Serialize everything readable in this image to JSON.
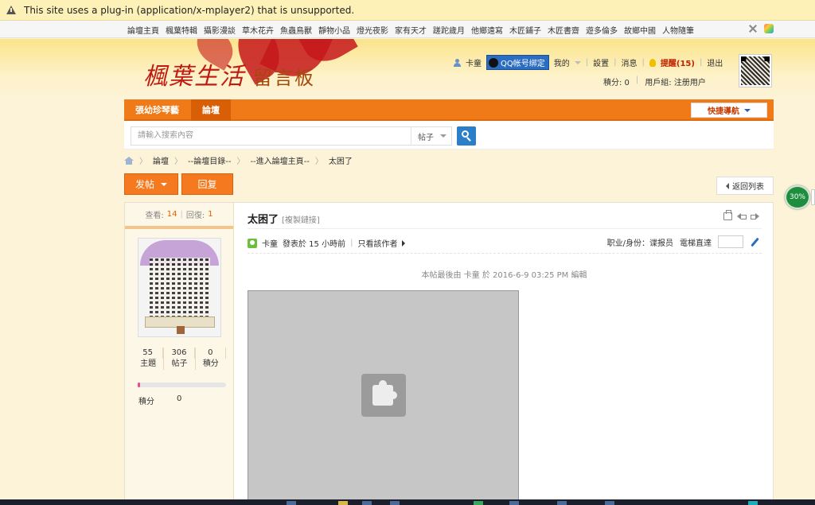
{
  "plugin_bar": {
    "message": "This site uses a plug-in (application/x-mplayer2) that is unsupported."
  },
  "top_links": [
    "論壇主頁",
    "楓葉特輯",
    "攝影漫談",
    "草木花卉",
    "魚蟲鳥獸",
    "靜物小品",
    "燈光夜影",
    "家有天才",
    "蹉跎歲月",
    "他鄉遠寫",
    "木匠鋪子",
    "木匠書齋",
    "遊多倫多",
    "故鄉中國",
    "人物隨筆"
  ],
  "header": {
    "logo_main": "楓葉生活",
    "logo_sub": "留言板",
    "username": "卡童",
    "qq_bind": "QQ帐号绑定",
    "my": "我的",
    "settings": "設置",
    "messages": "消息",
    "remind": "提醒(15)",
    "logout": "退出",
    "points": "積分: 0",
    "usergroup": "用戶組: 注册用户"
  },
  "navbar": {
    "tab1": "張幼珍琴藝",
    "tab2": "論壇",
    "quick_nav": "快捷導航"
  },
  "search": {
    "placeholder": "請輸入搜索內容",
    "type": "帖子"
  },
  "breadcrumb": [
    "論壇",
    "--論壇目錄--",
    "--進入論壇主頁--",
    "太困了"
  ],
  "actions": {
    "post": "发帖",
    "reply": "回复",
    "back_list": "返回列表"
  },
  "progress_badge": "30%",
  "sidebar": {
    "views_label": "查看:",
    "views": "14",
    "replies_label": "回復:",
    "replies": "1",
    "counts": [
      {
        "value": "55",
        "label": "主題"
      },
      {
        "value": "306",
        "label": "帖子"
      },
      {
        "value": "0",
        "label": "積分"
      }
    ],
    "score_label": "積分",
    "score_value": "0",
    "score_progress": 0.03
  },
  "post": {
    "title": "太困了",
    "copy_link": "[複製鏈接]",
    "author": "卡童",
    "posted": "發表於 15 小時前",
    "only_author": "只看該作者",
    "role": "职业/身份：谍报员",
    "jump": "電梯直達",
    "edit_note": "本帖最後由 卡童 於 2016-6-9 03:25 PM 編輯"
  }
}
